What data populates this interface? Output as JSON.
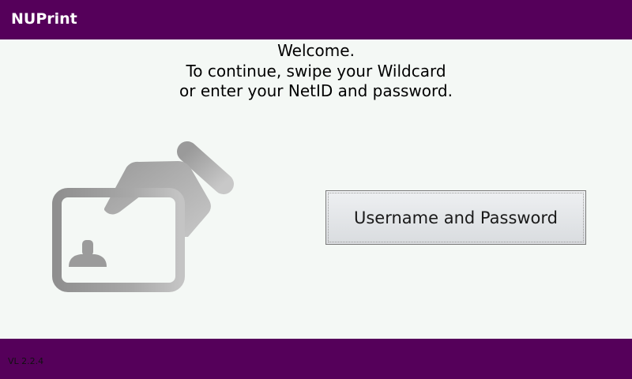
{
  "app": {
    "title": "NUPrint"
  },
  "welcome": {
    "line1": "Welcome.",
    "line2": "To continue, swipe your Wildcard",
    "line3": "or enter your NetID and password."
  },
  "illustration": {
    "icon": "card-swipe-icon"
  },
  "login": {
    "button_label": "Username and Password"
  },
  "footer": {
    "version": "VL 2.2.4"
  },
  "colors": {
    "brand": "#55005a",
    "background": "#f4f8f5"
  }
}
